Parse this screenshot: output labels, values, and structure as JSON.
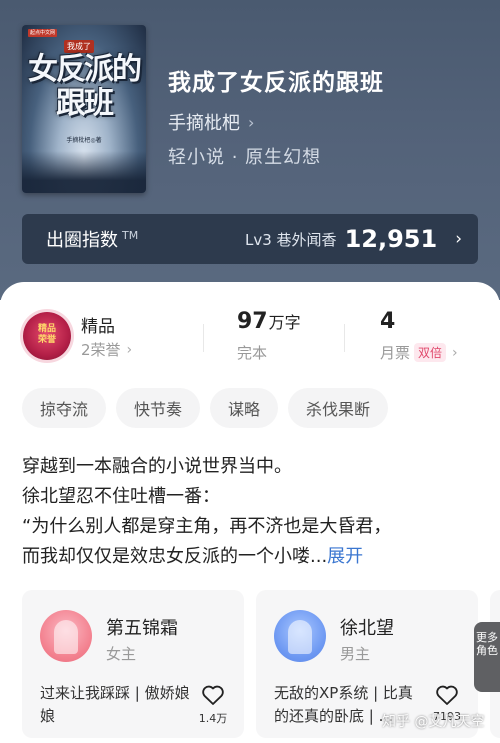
{
  "book": {
    "cover_badge": "起点中文网",
    "cover_top": "我成了",
    "cover_title": "女反派的跟班",
    "cover_author": "手摘枇杷◎著",
    "title": "我成了女反派的跟班",
    "author": "手摘枇杷",
    "genre": "轻小说 · 原生幻想"
  },
  "index_bar": {
    "label": "出圈指数",
    "tm": "TM",
    "level": "Lv3 巷外闻香",
    "value": "12,951"
  },
  "stats": {
    "medal_text": "精品\n荣誉",
    "quality_title": "精品",
    "quality_sub": "2荣誉",
    "word_count": "97",
    "word_unit": "万字",
    "word_label": "完本",
    "votes": "4",
    "votes_label": "月票",
    "votes_badge": "双倍"
  },
  "tags": [
    "掠夺流",
    "快节奏",
    "谋略",
    "杀伐果断"
  ],
  "synopsis": {
    "line1": "穿越到一本融合的小说世界当中。",
    "line2": "徐北望忍不住吐槽一番：",
    "line3": "“为什么别人都是穿主角，再不济也是大昏君，",
    "line4": "而我却仅仅是效忠女反派的一个小喽...",
    "expand": "展开"
  },
  "roles": [
    {
      "name": "第五锦霜",
      "gender": "女主",
      "desc": "过来让我踩踩 | 傲娇娘娘",
      "likes": "1.4万"
    },
    {
      "name": "徐北望",
      "gender": "男主",
      "desc": "无敌的XP系统 | 比真的还真的卧底 | ...",
      "likes": "7193"
    }
  ],
  "more_roles": "更多角色",
  "watermark": "知乎 @艾凡天空",
  "colors": {
    "hero_bg": "#54637a",
    "index_bg": "#2d3a4d",
    "accent_blue": "#3a76d0",
    "badge_pink": "#e0486b"
  }
}
